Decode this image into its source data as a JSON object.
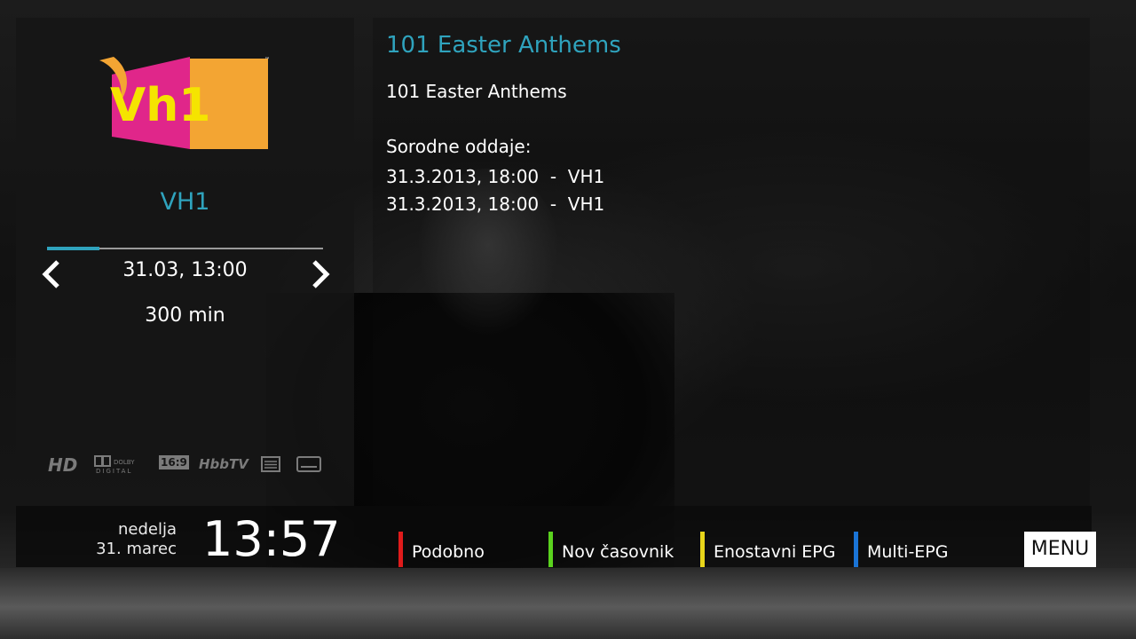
{
  "channel": {
    "name": "VH1",
    "logo_text": "Vh1"
  },
  "event": {
    "time": "31.03, 13:00",
    "duration": "300 min",
    "progress": 0.19,
    "title": "101 Easter Anthems",
    "subtitle": "101 Easter Anthems",
    "related_heading": "Sorodne oddaje:",
    "related": [
      "31.3.2013, 18:00  -  VH1",
      "31.3.2013, 18:00  -  VH1"
    ]
  },
  "features": {
    "hd": "HD",
    "dolby": "DOLBY DIGITAL",
    "aspect": "16:9",
    "hbbtv": "HbbTV",
    "teletext": "teletext-icon",
    "subtitles": "subtitles-icon"
  },
  "clock": {
    "day": "nedelja",
    "date": "31. marec",
    "time": "13:57"
  },
  "buttons": {
    "red": "Podobno",
    "green": "Nov časovnik",
    "yellow": "Enostavni EPG",
    "blue": "Multi-EPG",
    "menu": "MENU"
  },
  "colors": {
    "accent": "#2fa3bd",
    "red": "#e01b1b",
    "green": "#5ad21e",
    "yellow": "#e8d51a",
    "blue": "#1a74d6"
  }
}
